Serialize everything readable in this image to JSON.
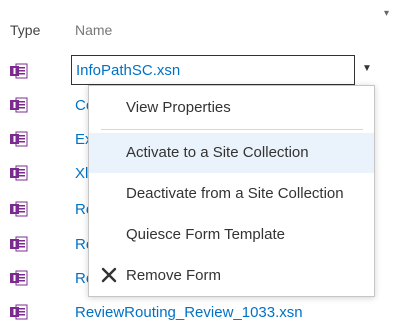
{
  "header": {
    "type_label": "Type",
    "name_label": "Name"
  },
  "selected_row": {
    "name": "InfoPathSC.xsn"
  },
  "rows": [
    {
      "name": "Co"
    },
    {
      "name": "Ex"
    },
    {
      "name": "Xl"
    },
    {
      "name": "Re"
    },
    {
      "name": "Re"
    },
    {
      "name": "Re"
    },
    {
      "name": "ReviewRouting_Review_1033.xsn"
    }
  ],
  "context_menu": {
    "items": [
      {
        "label": "View Properties"
      },
      {
        "label": "Activate to a Site Collection"
      },
      {
        "label": "Deactivate from a Site Collection"
      },
      {
        "label": "Quiesce Form Template"
      },
      {
        "label": "Remove Form",
        "icon": "x-icon"
      }
    ]
  },
  "icons": {
    "row_type": "infopath-form-icon",
    "remove": "x-icon",
    "caret": "chevron-down-icon"
  },
  "colors": {
    "link": "#0072c6",
    "hover": "#eaf3fb",
    "infopath": "#7b2b8f"
  }
}
